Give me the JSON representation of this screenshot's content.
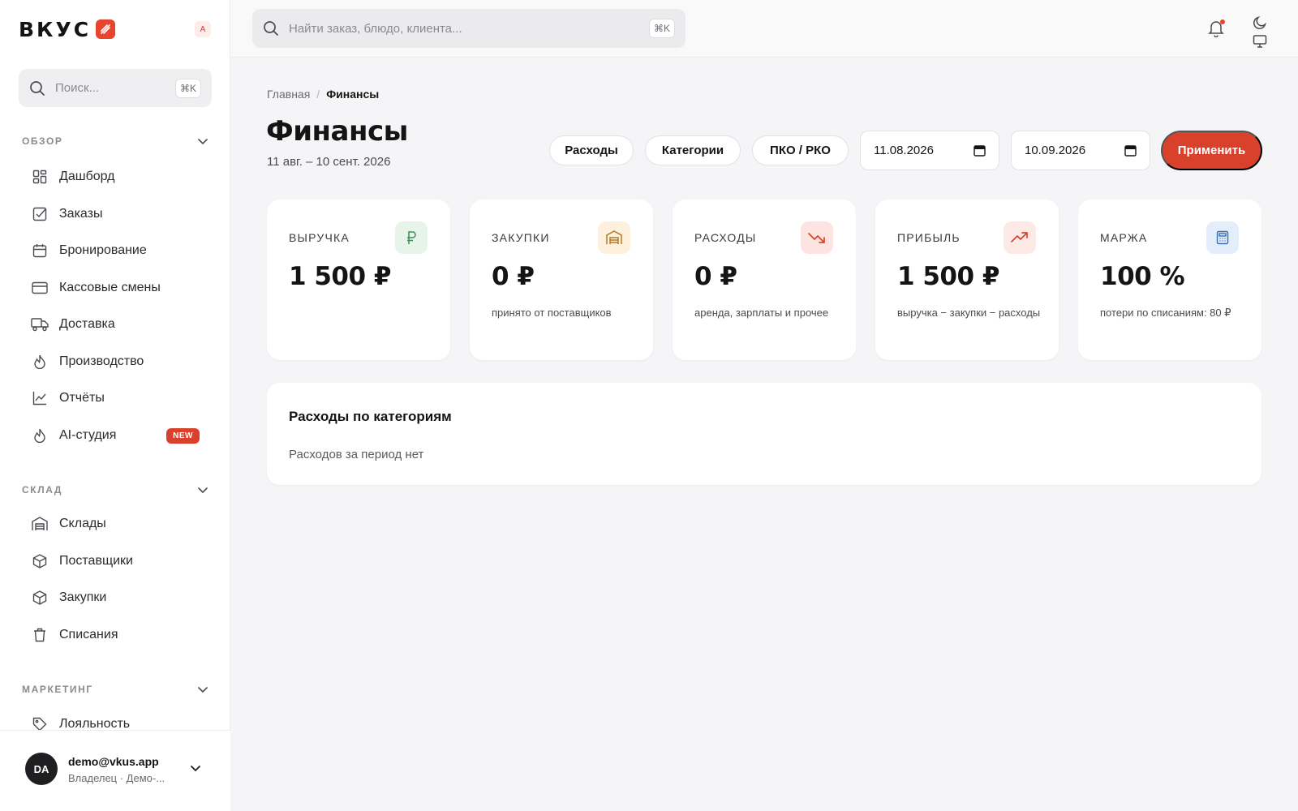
{
  "brand": {
    "name": "ВКУС",
    "lang_badge": "A"
  },
  "sidebar": {
    "search": {
      "placeholder": "Поиск...",
      "shortcut": "⌘K"
    },
    "sections": [
      {
        "title": "ОБЗОР",
        "items": [
          {
            "label": "Дашборд",
            "icon": "dashboard-icon"
          },
          {
            "label": "Заказы",
            "icon": "checkbox-icon"
          },
          {
            "label": "Бронирование",
            "icon": "calendar-icon"
          },
          {
            "label": "Кассовые смены",
            "icon": "card-icon"
          },
          {
            "label": "Доставка",
            "icon": "truck-icon"
          },
          {
            "label": "Производство",
            "icon": "flame-icon"
          },
          {
            "label": "Отчёты",
            "icon": "chart-icon"
          },
          {
            "label": "AI-студия",
            "icon": "flame-icon",
            "badge": "NEW"
          }
        ]
      },
      {
        "title": "СКЛАД",
        "items": [
          {
            "label": "Склады",
            "icon": "warehouse-icon"
          },
          {
            "label": "Поставщики",
            "icon": "box-icon"
          },
          {
            "label": "Закупки",
            "icon": "box-icon"
          },
          {
            "label": "Списания",
            "icon": "trash-icon"
          }
        ]
      },
      {
        "title": "МАРКЕТИНГ",
        "items": [
          {
            "label": "Лояльность",
            "icon": "tag-icon"
          }
        ]
      }
    ],
    "user": {
      "initials": "DA",
      "email": "demo@vkus.app",
      "role": "Владелец · Демо-..."
    }
  },
  "topbar": {
    "search": {
      "placeholder": "Найти заказ, блюдо, клиента...",
      "shortcut": "⌘K"
    }
  },
  "page": {
    "breadcrumb": {
      "home": "Главная",
      "separator": "/",
      "current": "Финансы"
    },
    "title": "Финансы",
    "subtitle": "11 авг. – 10 сент. 2026",
    "actions": {
      "expenses": "Расходы",
      "categories": "Категории",
      "pko_rko": "ПКО / РКО",
      "date_from": "11.08.2026",
      "date_to": "10.09.2026",
      "apply": "Применить"
    },
    "cards": [
      {
        "label": "ВЫРУЧКА",
        "value": "1 500 ₽",
        "note": "",
        "icon": "ruble-icon",
        "icon_bg": "#e6f4ea",
        "icon_color": "#3d8a56"
      },
      {
        "label": "ЗАКУПКИ",
        "value": "0 ₽",
        "note": "принято от поставщиков",
        "icon": "warehouse-icon",
        "icon_bg": "#fdf1dd",
        "icon_color": "#b07a2a"
      },
      {
        "label": "РАСХОДЫ",
        "value": "0 ₽",
        "note": "аренда, зарплаты и прочее",
        "icon": "trend-down-icon",
        "icon_bg": "#fde4e1",
        "icon_color": "#d9412c"
      },
      {
        "label": "ПРИБЫЛЬ",
        "value": "1 500 ₽",
        "note": "выручка − закупки − расходы",
        "icon": "trend-up-icon",
        "icon_bg": "#fde9e6",
        "icon_color": "#d9412c"
      },
      {
        "label": "МАРЖА",
        "value": "100 %",
        "note": "потери по списаниям: 80 ₽",
        "icon": "calculator-icon",
        "icon_bg": "#e4eefa",
        "icon_color": "#3a6fb0"
      }
    ],
    "categories_panel": {
      "title": "Расходы по категориям",
      "empty": "Расходов за период нет"
    }
  },
  "colors": {
    "accent": "#d9412c",
    "background": "#f5f5f7",
    "surface": "#ffffff"
  }
}
